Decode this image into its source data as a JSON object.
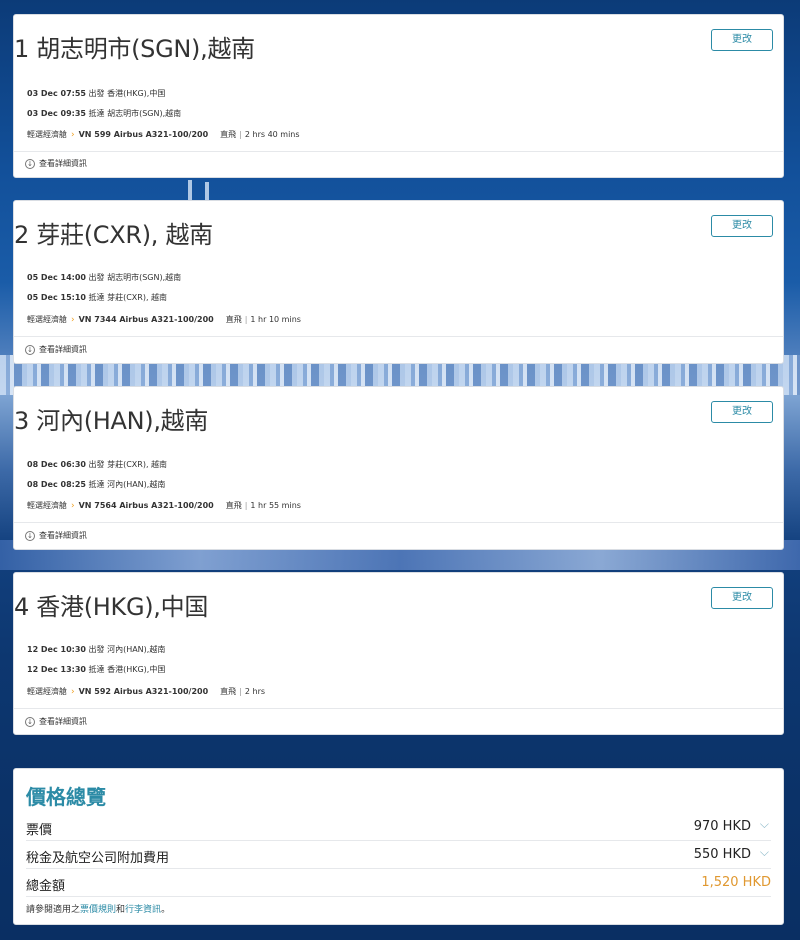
{
  "segments": [
    {
      "title": "1 胡志明市(SGN),越南",
      "change_label": "更改",
      "depart": {
        "date_time": "03 Dec 07:55",
        "verb": "出發",
        "place": "香港(HKG),中国"
      },
      "arrive": {
        "date_time": "03 Dec 09:35",
        "verb": "抵達",
        "place": "胡志明市(SGN),越南"
      },
      "cabin": "輕選經濟艙",
      "flight": "VN 599 Airbus A321-100/200",
      "stops": "直飛",
      "duration": "2 hrs 40 mins",
      "details_label": "查看詳細資訊"
    },
    {
      "title": "2 芽莊(CXR), 越南",
      "change_label": "更改",
      "depart": {
        "date_time": "05 Dec 14:00",
        "verb": "出發",
        "place": "胡志明市(SGN),越南"
      },
      "arrive": {
        "date_time": "05 Dec 15:10",
        "verb": "抵達",
        "place": "芽莊(CXR), 越南"
      },
      "cabin": "輕選經濟艙",
      "flight": "VN 7344 Airbus A321-100/200",
      "stops": "直飛",
      "duration": "1 hr 10 mins",
      "details_label": "查看詳細資訊"
    },
    {
      "title": "3 河內(HAN),越南",
      "change_label": "更改",
      "depart": {
        "date_time": "08 Dec 06:30",
        "verb": "出發",
        "place": "芽莊(CXR), 越南"
      },
      "arrive": {
        "date_time": "08 Dec 08:25",
        "verb": "抵達",
        "place": "河內(HAN),越南"
      },
      "cabin": "輕選經濟艙",
      "flight": "VN 7564 Airbus A321-100/200",
      "stops": "直飛",
      "duration": "1 hr 55 mins",
      "details_label": "查看詳細資訊"
    },
    {
      "title": "4 香港(HKG),中国",
      "change_label": "更改",
      "depart": {
        "date_time": "12 Dec 10:30",
        "verb": "出發",
        "place": "河內(HAN),越南"
      },
      "arrive": {
        "date_time": "12 Dec 13:30",
        "verb": "抵達",
        "place": "香港(HKG),中国"
      },
      "cabin": "輕選經濟艙",
      "flight": "VN 592 Airbus A321-100/200",
      "stops": "直飛",
      "duration": "2 hrs",
      "details_label": "查看詳細資訊"
    }
  ],
  "price": {
    "title": "價格總覽",
    "fare_label": "票價",
    "fare_value": "970 HKD",
    "taxes_label": "稅金及航空公司附加費用",
    "taxes_value": "550 HKD",
    "total_label": "總金額",
    "total_value": "1,520 HKD",
    "note_prefix": "請參閱適用之",
    "fare_rules_link": "票價規則",
    "note_and": "和",
    "baggage_link": "行李資訊",
    "note_suffix": "。"
  },
  "colors": {
    "accent": "#2c8ba6",
    "total": "#e09830",
    "cabin_arrow": "#f0a020"
  }
}
